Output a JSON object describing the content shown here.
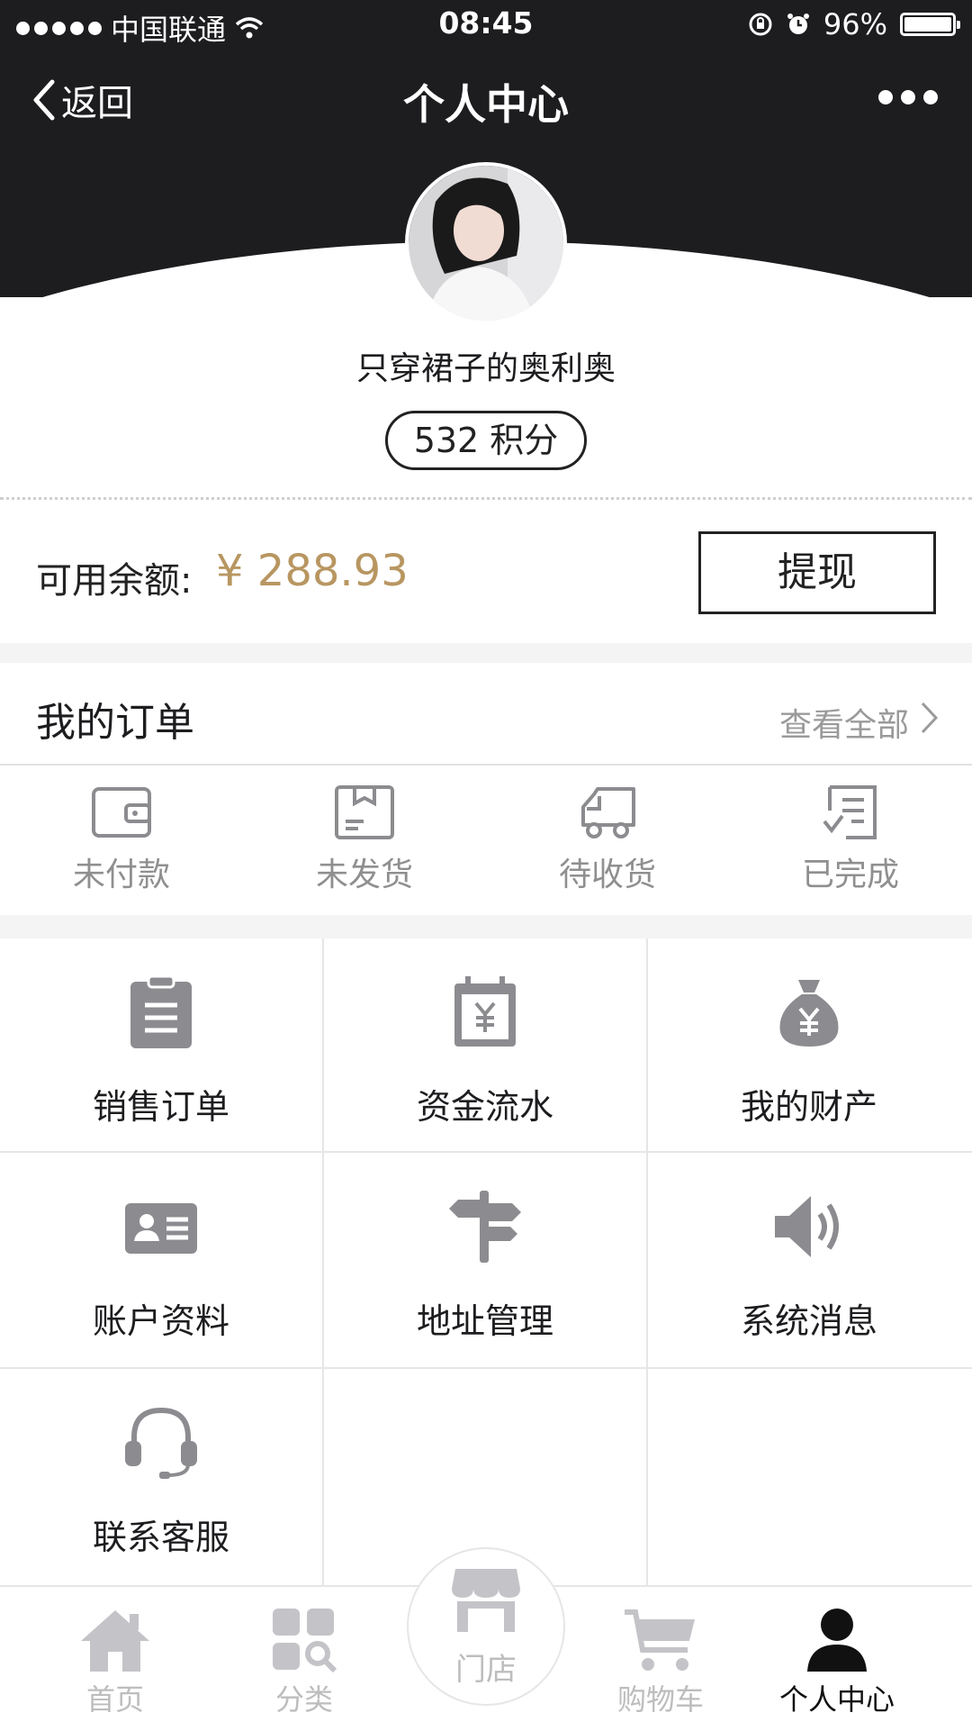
{
  "status_bar": {
    "carrier": "中国联通",
    "time": "08:45",
    "battery": "96%"
  },
  "nav": {
    "back_label": "返回",
    "title": "个人中心"
  },
  "profile": {
    "username": "只穿裙子的奥利奥",
    "points": "532 积分"
  },
  "balance": {
    "label": "可用余额:",
    "value": "¥ 288.93",
    "withdraw_label": "提现",
    "value_color": "#b89661"
  },
  "orders": {
    "title": "我的订单",
    "view_all": "查看全部",
    "statuses": [
      {
        "label": "未付款",
        "icon": "wallet-icon"
      },
      {
        "label": "未发货",
        "icon": "package-icon"
      },
      {
        "label": "待收货",
        "icon": "truck-icon"
      },
      {
        "label": "已完成",
        "icon": "checklist-icon"
      }
    ]
  },
  "menu": [
    {
      "label": "销售订单",
      "icon": "clipboard-icon"
    },
    {
      "label": "资金流水",
      "icon": "calendar-yen-icon"
    },
    {
      "label": "我的财产",
      "icon": "money-bag-icon"
    },
    {
      "label": "账户资料",
      "icon": "id-card-icon"
    },
    {
      "label": "地址管理",
      "icon": "signpost-icon"
    },
    {
      "label": "系统消息",
      "icon": "speaker-icon"
    },
    {
      "label": "联系客服",
      "icon": "headset-icon"
    }
  ],
  "tabbar": {
    "items": [
      {
        "label": "首页",
        "icon": "home-icon"
      },
      {
        "label": "分类",
        "icon": "category-icon"
      },
      {
        "label": "门店",
        "icon": "store-icon"
      },
      {
        "label": "购物车",
        "icon": "cart-icon"
      },
      {
        "label": "个人中心",
        "icon": "user-icon"
      }
    ],
    "active": "个人中心"
  },
  "colors": {
    "header_bg": "#1d1d20",
    "accent_gold": "#b89661",
    "icon_gray": "#8c8c90",
    "muted_text": "#8f8f8f"
  }
}
